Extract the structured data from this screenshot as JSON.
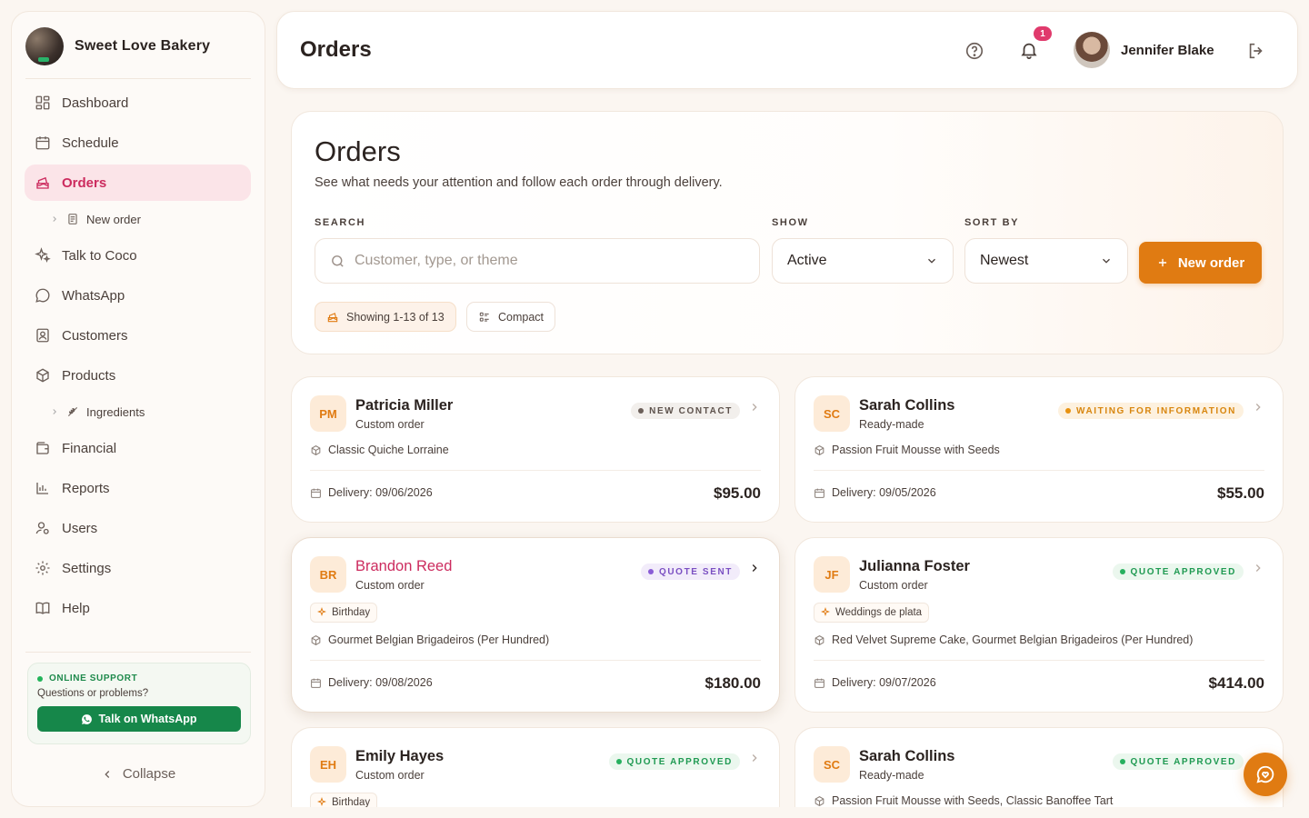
{
  "brand": {
    "name": "Sweet Love Bakery"
  },
  "nav": {
    "dashboard": "Dashboard",
    "schedule": "Schedule",
    "orders": "Orders",
    "new_order": "New order",
    "talk_coco": "Talk to Coco",
    "whatsapp": "WhatsApp",
    "customers": "Customers",
    "products": "Products",
    "ingredients": "Ingredients",
    "financial": "Financial",
    "reports": "Reports",
    "users": "Users",
    "settings": "Settings",
    "help": "Help"
  },
  "support": {
    "title": "ONLINE SUPPORT",
    "subtitle": "Questions or problems?",
    "button": "Talk on WhatsApp"
  },
  "collapse_label": "Collapse",
  "header": {
    "title": "Orders",
    "notification_count": "1",
    "user_name": "Jennifer Blake"
  },
  "panel": {
    "title": "Orders",
    "subtitle": "See what needs your attention and follow each order through delivery.",
    "search_label": "SEARCH",
    "search_placeholder": "Customer, type, or theme",
    "show_label": "SHOW",
    "show_value": "Active",
    "sort_label": "SORT BY",
    "sort_value": "Newest",
    "new_order_button": "New order",
    "showing_chip": "Showing 1-13 of 13",
    "compact_chip": "Compact"
  },
  "orders": [
    {
      "initials": "PM",
      "name": "Patricia Miller",
      "type": "Custom order",
      "status": "NEW CONTACT",
      "status_kind": "new",
      "tag": "",
      "products": "Classic Quiche Lorraine",
      "delivery": "Delivery: 09/06/2026",
      "price": "$95.00"
    },
    {
      "initials": "SC",
      "name": "Sarah Collins",
      "type": "Ready-made",
      "status": "WAITING FOR INFORMATION",
      "status_kind": "wait",
      "tag": "",
      "products": "Passion Fruit Mousse with Seeds",
      "delivery": "Delivery: 09/05/2026",
      "price": "$55.00"
    },
    {
      "initials": "BR",
      "name": "Brandon Reed",
      "type": "Custom order",
      "status": "QUOTE SENT",
      "status_kind": "quote",
      "tag": "Birthday",
      "products": "Gourmet Belgian Brigadeiros (Per Hundred)",
      "delivery": "Delivery: 09/08/2026",
      "price": "$180.00"
    },
    {
      "initials": "JF",
      "name": "Julianna Foster",
      "type": "Custom order",
      "status": "QUOTE APPROVED",
      "status_kind": "approved",
      "tag": "Weddings de plata",
      "products": "Red Velvet Supreme Cake, Gourmet Belgian Brigadeiros (Per Hundred)",
      "delivery": "Delivery: 09/07/2026",
      "price": "$414.00"
    },
    {
      "initials": "EH",
      "name": "Emily Hayes",
      "type": "Custom order",
      "status": "QUOTE APPROVED",
      "status_kind": "approved",
      "tag": "Birthday",
      "products": "",
      "delivery": "",
      "price": ""
    },
    {
      "initials": "SC",
      "name": "Sarah Collins",
      "type": "Ready-made",
      "status": "QUOTE APPROVED",
      "status_kind": "approved",
      "tag": "",
      "products": "Passion Fruit Mousse with Seeds, Classic Banoffee Tart",
      "delivery": "",
      "price": ""
    }
  ],
  "colors": {
    "accent": "#e07b12",
    "active_nav": "#cc2b5e",
    "active_nav_bg": "#fbe4e8",
    "whatsapp_green": "#16874a"
  }
}
